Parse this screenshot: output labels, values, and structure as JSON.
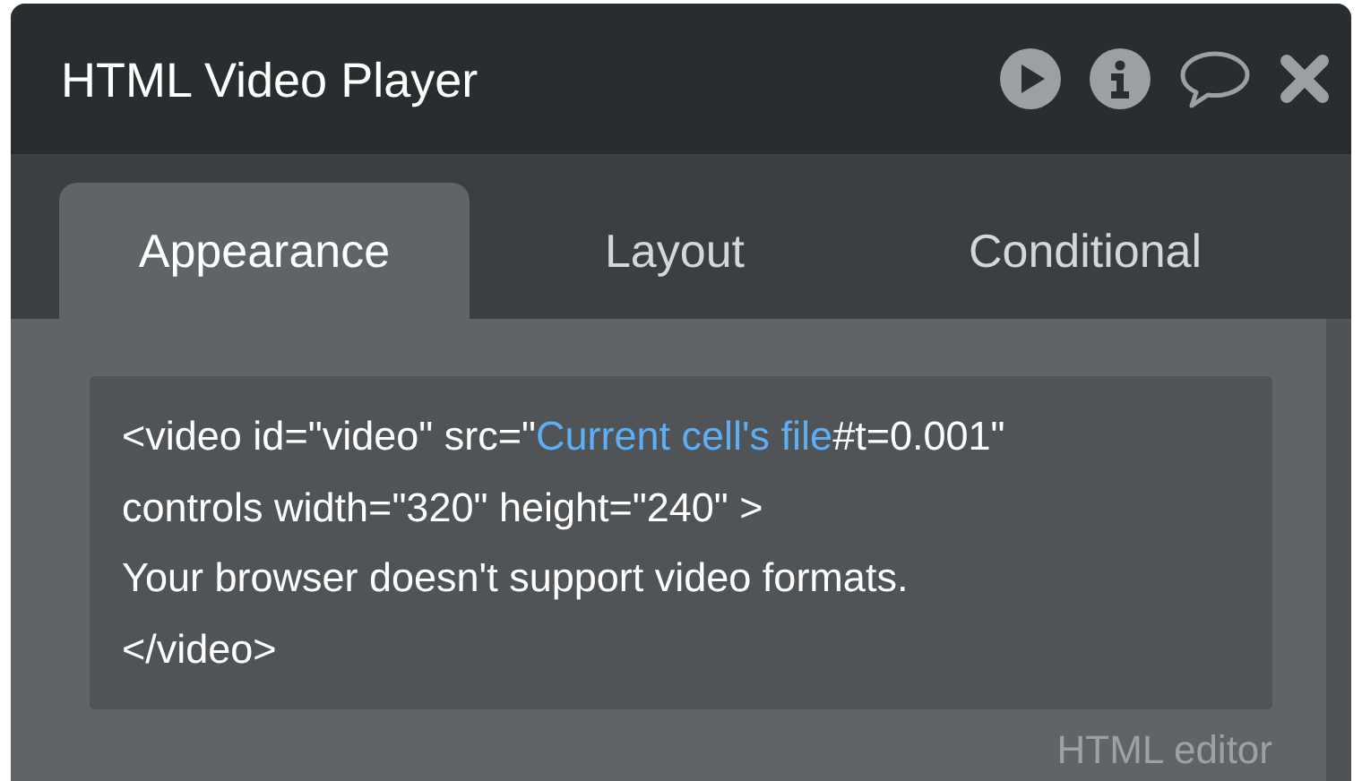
{
  "window": {
    "title": "HTML Video Player"
  },
  "tabs": [
    {
      "label": "Appearance",
      "selected": true
    },
    {
      "label": "Layout",
      "selected": false
    },
    {
      "label": "Conditional",
      "selected": false
    }
  ],
  "editor": {
    "lines": [
      [
        {
          "kind": "text",
          "text": "<video id=\"video\" src=\""
        },
        {
          "kind": "dynamic",
          "text": "Current cell's file"
        },
        {
          "kind": "text",
          "text": "#t=0.001\""
        }
      ],
      [
        {
          "kind": "text",
          "text": "controls width=\"320\" height=\"240\" >"
        }
      ],
      [
        {
          "kind": "text",
          "text": "Your browser doesn't support video formats."
        }
      ],
      [
        {
          "kind": "text",
          "text": "</video>"
        }
      ]
    ],
    "caption": "HTML editor"
  }
}
